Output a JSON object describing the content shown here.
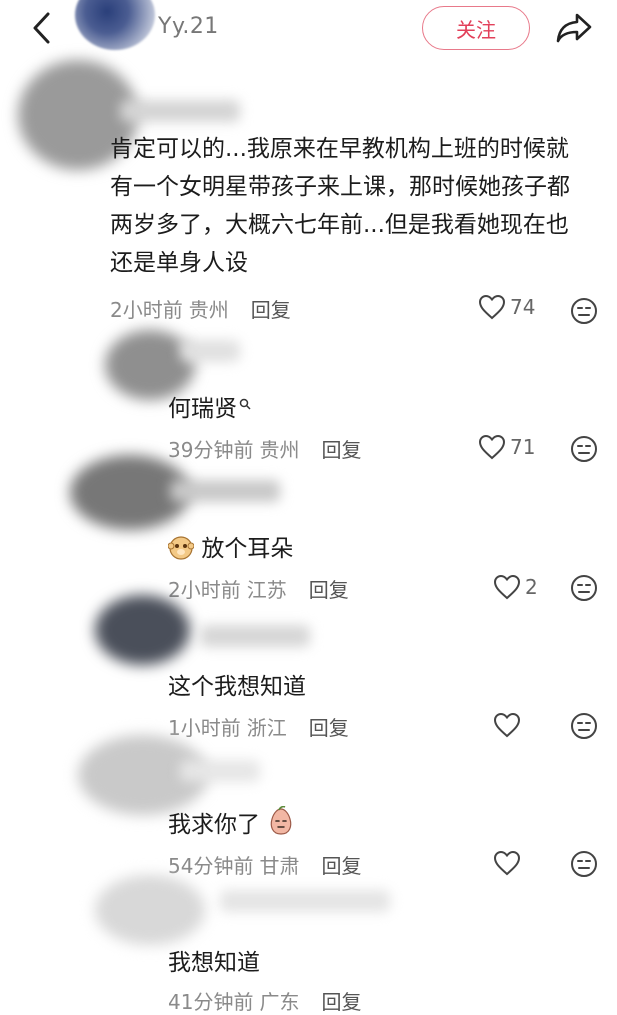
{
  "header": {
    "username": "Yy.21",
    "follow_label": "关注"
  },
  "comments": [
    {
      "text": "肯定可以的...我原来在早教机构上班的时候就有一个女明星带孩子来上课，那时候她孩子都两岁多了，大概六七年前...但是我看她现在也还是单身人设",
      "time": "2小时前",
      "location": "贵州",
      "reply": "回复",
      "likes": "74"
    },
    {
      "text": "何瑞贤",
      "time": "39分钟前",
      "location": "贵州",
      "reply": "回复",
      "likes": "71"
    },
    {
      "text": "放个耳朵",
      "time": "2小时前",
      "location": "江苏",
      "reply": "回复",
      "likes": "2"
    },
    {
      "text": "这个我想知道",
      "time": "1小时前",
      "location": "浙江",
      "reply": "回复",
      "likes": ""
    },
    {
      "text": "我求你了",
      "time": "54分钟前",
      "location": "甘肃",
      "reply": "回复",
      "likes": ""
    },
    {
      "text": "我想知道",
      "time": "41分钟前",
      "location": "广东",
      "reply": "回复",
      "likes": ""
    }
  ],
  "colors": {
    "accent": "#e2405a",
    "meta": "#8a8a8a"
  }
}
